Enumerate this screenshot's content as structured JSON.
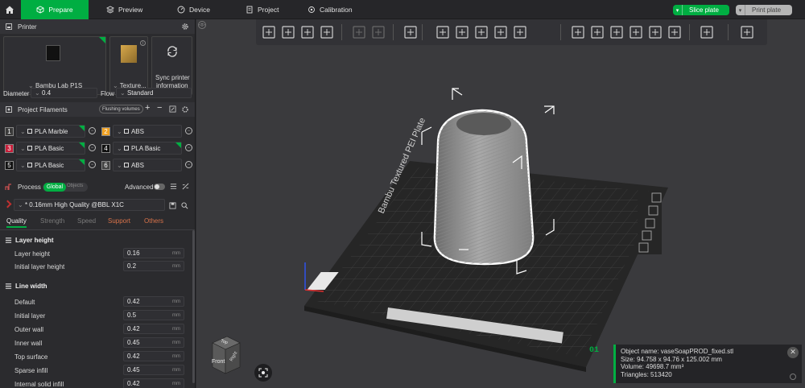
{
  "topbar": {
    "tabs": [
      {
        "label": "Prepare",
        "icon": "cube-icon"
      },
      {
        "label": "Preview",
        "icon": "layers-icon"
      },
      {
        "label": "Device",
        "icon": "gauge-icon"
      },
      {
        "label": "Project",
        "icon": "document-icon"
      },
      {
        "label": "Calibration",
        "icon": "calibration-icon"
      }
    ],
    "slice_label": "Slice plate",
    "print_label": "Print plate"
  },
  "printer": {
    "section_title": "Printer",
    "printer_name": "Bambu Lab P1S",
    "plate_label": "Texture...",
    "sync_label_1": "Sync printer",
    "sync_label_2": "information",
    "diameter_label": "Diameter",
    "diameter_value": "0.4",
    "flow_label": "Flow",
    "flow_value": "Standard"
  },
  "filaments": {
    "section_title": "Project Filaments",
    "flushing_label": "Flushing volumes",
    "items": [
      {
        "num": "1",
        "name": "PLA Marble",
        "color": "#3a3a3a",
        "flag": true
      },
      {
        "num": "2",
        "name": "ABS",
        "color": "#f0a020",
        "flag": false
      },
      {
        "num": "3",
        "name": "PLA Basic",
        "color": "#c81e3a",
        "flag": true
      },
      {
        "num": "4",
        "name": "PLA Basic",
        "color": "#111111",
        "flag": true
      },
      {
        "num": "5",
        "name": "PLA Basic",
        "color": "#111111",
        "flag": true
      },
      {
        "num": "6",
        "name": "ABS",
        "color": "#444444",
        "flag": false
      }
    ]
  },
  "process": {
    "section_title": "Process",
    "global_label": "Global",
    "objects_label": "Objects",
    "advanced_label": "Advanced",
    "preset": "* 0.16mm High Quality @BBL X1C",
    "tabs": [
      "Quality",
      "Strength",
      "Speed",
      "Support",
      "Others"
    ],
    "layer_height_group": "Layer height",
    "layer_height_label": "Layer height",
    "layer_height_value": "0.16",
    "initial_layer_height_label": "Initial layer height",
    "initial_layer_height_value": "0.2",
    "line_width_group": "Line width",
    "unit_mm": "mm",
    "line_widths": [
      {
        "label": "Default",
        "value": "0.42"
      },
      {
        "label": "Initial layer",
        "value": "0.5"
      },
      {
        "label": "Outer wall",
        "value": "0.42"
      },
      {
        "label": "Inner wall",
        "value": "0.45"
      },
      {
        "label": "Top surface",
        "value": "0.42"
      },
      {
        "label": "Sparse infill",
        "value": "0.45"
      },
      {
        "label": "Internal solid infill",
        "value": "0.42"
      }
    ]
  },
  "viewport": {
    "plate_text": "Bambu Textured PEI Plate",
    "plate_number": "01",
    "cube_top": "Top",
    "cube_front": "Front",
    "cube_right": "Right"
  },
  "object_info": {
    "name_line": "Object name: vaseSoapPROD_fixed.stl",
    "size_line": "Size: 94.758 x 94.76 x 125.002 mm",
    "volume_line": "Volume: 49698.7 mm³",
    "triangles_line": "Triangles: 513420"
  },
  "colors": {
    "accent": "#00ae42"
  }
}
